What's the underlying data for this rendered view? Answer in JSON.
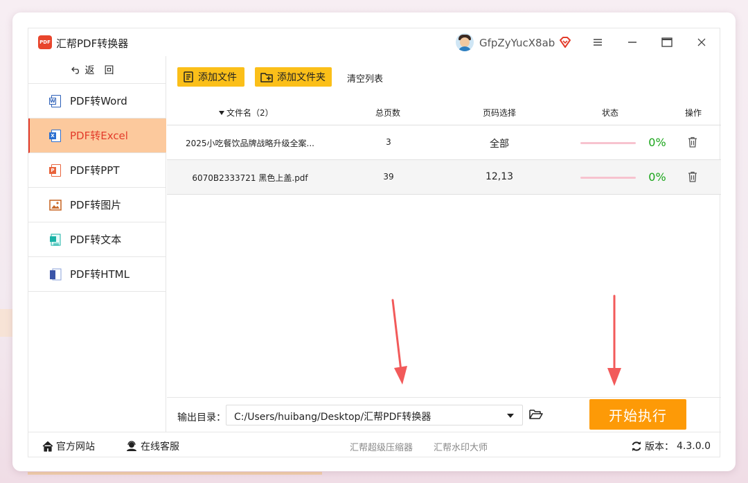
{
  "app": {
    "title": "汇帮PDF转换器",
    "logo_text": "PDF",
    "username": "GfpZyYucX8ab"
  },
  "sidebar": {
    "back_label": "返回",
    "items": [
      {
        "label": "PDF转Word",
        "icon": "word-icon",
        "badge": "W",
        "color": "#2b5fb8"
      },
      {
        "label": "PDF转Excel",
        "icon": "excel-icon",
        "badge": "X",
        "color": "#2b6fd1",
        "active": true
      },
      {
        "label": "PDF转PPT",
        "icon": "ppt-icon",
        "badge": "P",
        "color": "#e8643c"
      },
      {
        "label": "PDF转图片",
        "icon": "image-icon",
        "badge": "",
        "color": "#c96a2b"
      },
      {
        "label": "PDF转文本",
        "icon": "text-icon",
        "badge": "",
        "color": "#19b2a6"
      },
      {
        "label": "PDF转HTML",
        "icon": "html-icon",
        "badge": "",
        "color": "#3b55a8"
      }
    ]
  },
  "toolbar": {
    "add_file": "添加文件",
    "add_folder": "添加文件夹",
    "clear_list": "清空列表"
  },
  "table": {
    "headers": {
      "name": "文件名（2）",
      "pages": "总页数",
      "range": "页码选择",
      "status": "状态",
      "action": "操作"
    },
    "rows": [
      {
        "name": "2025小吃餐饮品牌战略升级全案...",
        "pages": "3",
        "range": "全部",
        "progress": "0%"
      },
      {
        "name": "6070B2333721 黑色上盖.pdf",
        "pages": "39",
        "range": "12,13",
        "progress": "0%"
      }
    ]
  },
  "output": {
    "label": "输出目录：",
    "path": "C:/Users/huibang/Desktop/汇帮PDF转换器",
    "start": "开始执行"
  },
  "footer": {
    "website": "官方网站",
    "support": "在线客服",
    "link1": "汇帮超级压缩器",
    "link2": "汇帮水印大师",
    "version_label": "版本：",
    "version": "4.3.0.0"
  },
  "colors": {
    "accent": "#fbbf19",
    "start": "#fd9a07",
    "active_bg": "#fcc99d",
    "active_text": "#e33b2a",
    "progress_green": "#1aa51a",
    "arrow": "#f25a5a"
  }
}
